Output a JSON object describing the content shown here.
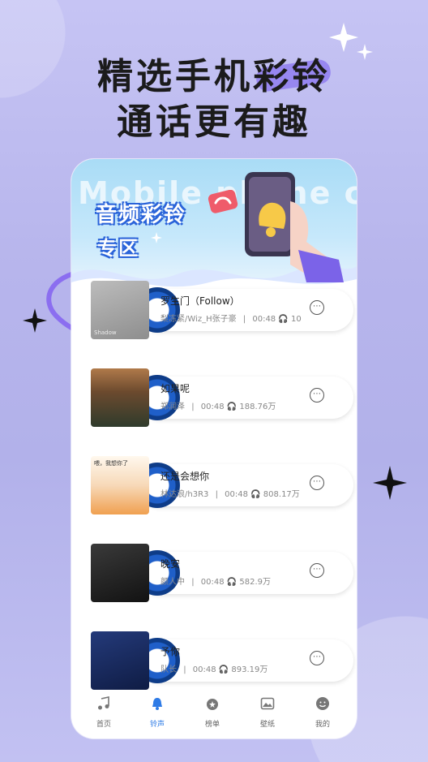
{
  "headline": {
    "line1": "精选手机彩铃",
    "line2": "通话更有趣"
  },
  "banner": {
    "watermark": "Mobile phone col",
    "title": "音频彩铃",
    "subtitle": "专区"
  },
  "songs": [
    {
      "title": "罗生门（Follow）",
      "artist": "梨冻紧/Wiz_H张子豪",
      "duration": "00:48",
      "plays": "10",
      "cover_text": "Shadow"
    },
    {
      "title": "如果呢",
      "artist": "郑润泽",
      "duration": "00:48",
      "plays": "188.76万",
      "cover_text": ""
    },
    {
      "title": "还是会想你",
      "artist": "林达浪/h3R3",
      "duration": "00:48",
      "plays": "808.17万",
      "cover_text": "喂，我想你了"
    },
    {
      "title": "晚安",
      "artist": "颜人中",
      "duration": "00:48",
      "plays": "582.9万",
      "cover_text": ""
    },
    {
      "title": "予你",
      "artist": "队长",
      "duration": "00:48",
      "plays": "893.19万",
      "cover_text": ""
    }
  ],
  "tabs": [
    {
      "label": "首页",
      "icon": "music-note-icon",
      "active": false
    },
    {
      "label": "铃声",
      "icon": "bell-icon",
      "active": true
    },
    {
      "label": "榜单",
      "icon": "medal-icon",
      "active": false
    },
    {
      "label": "壁纸",
      "icon": "image-icon",
      "active": false
    },
    {
      "label": "我的",
      "icon": "smile-face-icon",
      "active": false
    }
  ],
  "colors": {
    "accent": "#2e7be6",
    "background": "#b9b8ec",
    "banner": "#a9dcf6"
  }
}
